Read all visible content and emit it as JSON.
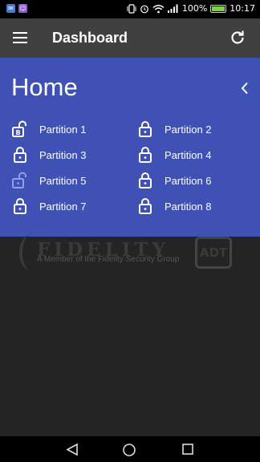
{
  "status_bar": {
    "battery_text": "100%",
    "time": "10:17",
    "battery_level": 1.0,
    "icons": [
      "app-icon-1",
      "app-icon-2",
      "vibrate-icon",
      "alarm-icon",
      "wifi-icon",
      "signal-icon",
      "battery-icon"
    ]
  },
  "app_bar": {
    "title": "Dashboard",
    "menu_icon": "menu-icon",
    "refresh_icon": "refresh-icon"
  },
  "panel": {
    "title": "Home",
    "collapse_icon": "chevron-left-icon",
    "partitions": [
      {
        "label": "Partition 1",
        "state": "unlocked-bypass"
      },
      {
        "label": "Partition 2",
        "state": "locked"
      },
      {
        "label": "Partition 3",
        "state": "locked"
      },
      {
        "label": "Partition 4",
        "state": "locked"
      },
      {
        "label": "Partition 5",
        "state": "unlocked"
      },
      {
        "label": "Partition 6",
        "state": "locked"
      },
      {
        "label": "Partition 7",
        "state": "locked"
      },
      {
        "label": "Partition 8",
        "state": "locked"
      }
    ]
  },
  "logo": {
    "name": "FIDELITY",
    "tagline": "A Member of the Fidelity Security Group",
    "partner": "ADT"
  },
  "nav_bar": {
    "icons": [
      "back-icon",
      "home-icon",
      "recents-icon"
    ]
  },
  "colors": {
    "panel": "#3f51b5",
    "app_bar": "#404040",
    "background": "#242424"
  }
}
